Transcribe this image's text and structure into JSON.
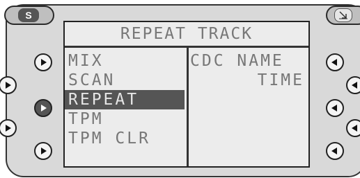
{
  "buttons": {
    "top_left_label": "S",
    "top_right_icon": "exit-arrow-icon"
  },
  "screen": {
    "title": "REPEAT TRACK",
    "menu": [
      "MIX",
      "SCAN",
      "REPEAT",
      "TPM",
      "TPM CLR"
    ],
    "selected_index": 2,
    "info": [
      "CDC NAME",
      "TIME"
    ]
  }
}
